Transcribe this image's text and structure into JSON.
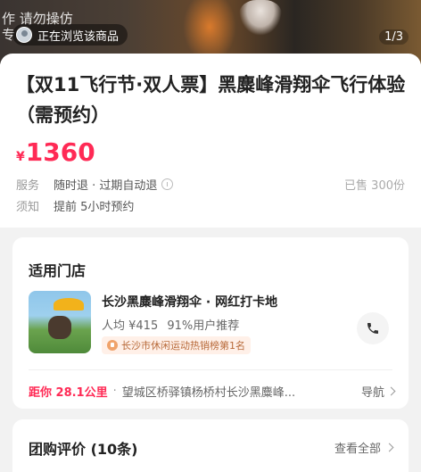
{
  "hero": {
    "overlay_text": "作 请勿操仿 专",
    "watching_text": "正在浏览该商品",
    "page_counter": "1/3"
  },
  "product": {
    "title": "【双11飞行节·双人票】黑麋峰滑翔伞飞行体验（需预约）",
    "currency": "¥",
    "price": "1360",
    "service_label": "服务",
    "service_value": "随时退 · 过期自动退",
    "sold": "已售 300份",
    "notice_label": "须知",
    "notice_value": "提前 5小时预约"
  },
  "store": {
    "heading": "适用门店",
    "name": "长沙黑麋峰滑翔伞 · 网红打卡地",
    "per_capita": "人均 ¥415",
    "recommend": "91%用户推荐",
    "rank": "长沙市休闲运动热销榜第1名",
    "distance": "距你 28.1公里",
    "separator": "·",
    "address": "望城区桥驿镇杨桥村长沙黑麋峰...",
    "nav_label": "导航"
  },
  "reviews": {
    "heading": "团购评价 (10条)",
    "view_all": "查看全部"
  },
  "colors": {
    "accent": "#ff2a55",
    "muted": "#999999"
  },
  "icons": {
    "service_info": "info-icon",
    "phone": "phone-icon",
    "rank": "medal-icon"
  }
}
